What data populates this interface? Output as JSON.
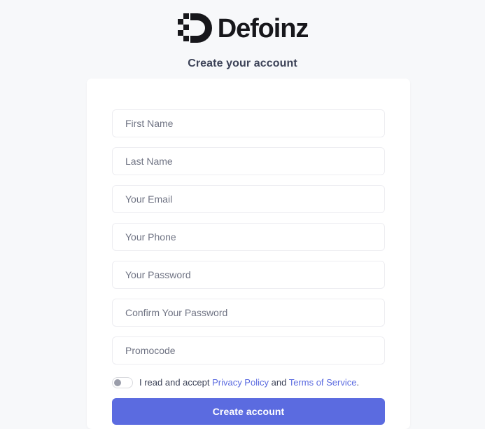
{
  "brand": {
    "logo_icon": "defoinz-logo-mark",
    "name": "Defoinz"
  },
  "header": {
    "title": "Create your account"
  },
  "form": {
    "fields": [
      {
        "name": "first-name",
        "placeholder": "First Name",
        "value": "",
        "type": "text"
      },
      {
        "name": "last-name",
        "placeholder": "Last Name",
        "value": "",
        "type": "text"
      },
      {
        "name": "email",
        "placeholder": "Your Email",
        "value": "",
        "type": "email"
      },
      {
        "name": "phone",
        "placeholder": "Your Phone",
        "value": "",
        "type": "tel"
      },
      {
        "name": "password",
        "placeholder": "Your Password",
        "value": "",
        "type": "password"
      },
      {
        "name": "confirm-password",
        "placeholder": "Confirm Your Password",
        "value": "",
        "type": "password"
      },
      {
        "name": "promocode",
        "placeholder": "Promocode",
        "value": "",
        "type": "text"
      }
    ],
    "terms": {
      "toggle_state": "off",
      "text_before": "I read and accept ",
      "privacy_link": "Privacy Policy",
      "text_between": " and ",
      "terms_link": "Terms of Service",
      "text_after": "."
    },
    "submit_label": "Create account"
  },
  "colors": {
    "accent": "#5b6be0",
    "page_background": "#f7f8fa",
    "card_background": "#ffffff",
    "heading_text": "#3c4257",
    "placeholder_text": "#707484",
    "field_border": "#ededf1",
    "logo": "#17171b"
  }
}
